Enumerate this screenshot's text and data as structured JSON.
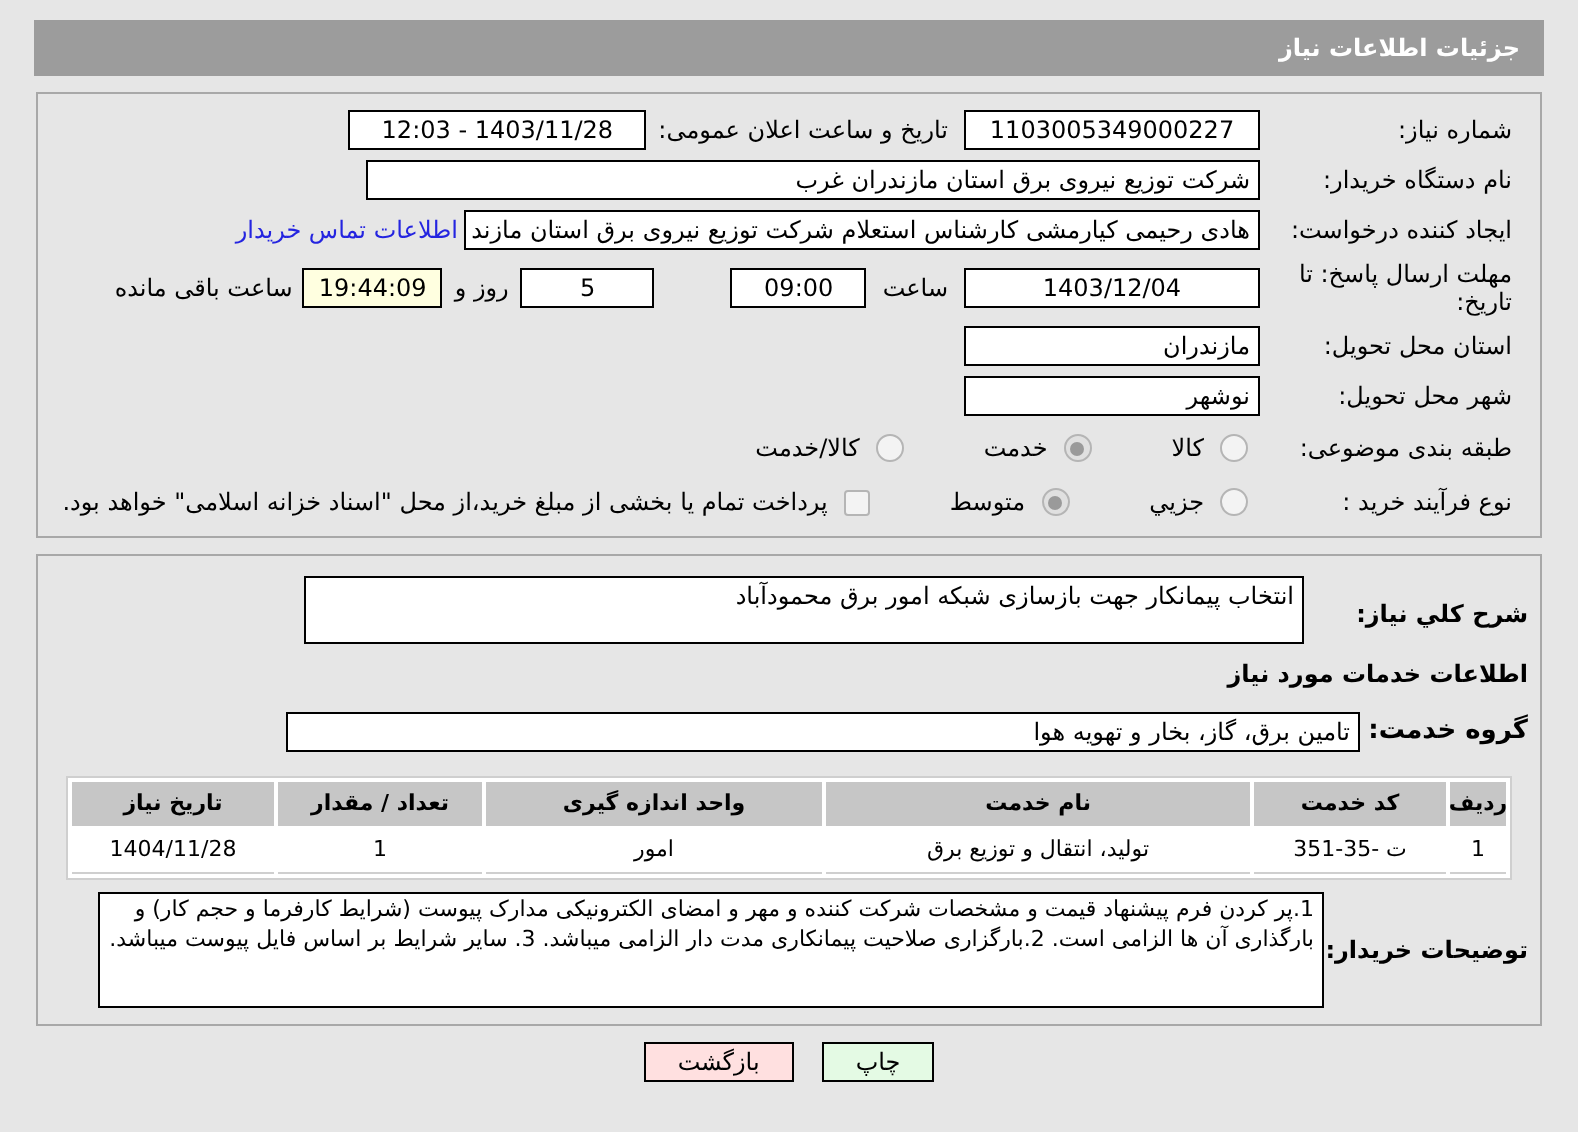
{
  "header": {
    "title": "جزئیات اطلاعات نیاز"
  },
  "details": {
    "need_number": {
      "label": "شماره نیاز:",
      "value": "1103005349000227"
    },
    "announce": {
      "label": "تاریخ و ساعت اعلان عمومی:",
      "value": "1403/11/28 - 12:03"
    },
    "buyer": {
      "label": "نام دستگاه خریدار:",
      "value": "شرکت توزیع نیروی برق استان مازندران غرب"
    },
    "creator": {
      "label": "ایجاد کننده درخواست:",
      "value": "هادی رحیمی کیارمشی کارشناس استعلام شرکت توزیع نیروی برق استان مازند",
      "link": "اطلاعات تماس خریدار"
    },
    "deadline": {
      "label": "مهلت ارسال پاسخ: تا تاریخ:",
      "date": "1403/12/04",
      "time_label": "ساعت",
      "time": "09:00",
      "days": "5",
      "days_label": "روز و",
      "remaining": "19:44:09",
      "remaining_label": "ساعت باقی مانده"
    },
    "province": {
      "label": "استان محل تحویل:",
      "value": "مازندران"
    },
    "city": {
      "label": "شهر محل تحویل:",
      "value": "نوشهر"
    },
    "category": {
      "label": "طبقه بندی موضوعی:",
      "options": [
        {
          "label": "کالا",
          "selected": false
        },
        {
          "label": "خدمت",
          "selected": true
        },
        {
          "label": "کالا/خدمت",
          "selected": false
        }
      ]
    },
    "process": {
      "label": "نوع فرآیند خرید :",
      "options": [
        {
          "label": "جزیي",
          "selected": false
        },
        {
          "label": "متوسط",
          "selected": true
        }
      ],
      "payment": {
        "checked": false,
        "text": "پرداخت تمام یا بخشی از مبلغ خرید،از محل \"اسناد خزانه اسلامی\" خواهد بود."
      }
    }
  },
  "services": {
    "description": {
      "label": "شرح کلي نياز:",
      "value": "انتخاب پیمانکار جهت بازسازی شبکه امور برق محمودآباد"
    },
    "section_title": "اطلاعات خدمات مورد نياز",
    "group": {
      "label": "گروه خدمت:",
      "value": "تامین برق، گاز، بخار و تهویه هوا"
    },
    "table": {
      "columns": [
        "ردیف",
        "کد خدمت",
        "نام خدمت",
        "واحد اندازه گیری",
        "تعداد / مقدار",
        "تاریخ نیاز"
      ],
      "rows": [
        [
          "1",
          "ت -35-351",
          "تولید، انتقال و توزیع برق",
          "امور",
          "1",
          "1404/11/28"
        ]
      ]
    },
    "notes": {
      "label": "توضیحات خریدار:",
      "value": "1.پر کردن فرم پیشنهاد قیمت و مشخصات شرکت کننده و مهر و امضای الکترونیکی مدارک پیوست (شرایط کارفرما و حجم کار) و بارگذاری آن ها الزامی است. 2.بارگزاری صلاحیت پیمانکاری مدت دار الزامی میباشد. 3. سایر شرایط بر اساس فایل پیوست میباشد."
    }
  },
  "buttons": [
    {
      "label": "چاپ",
      "kind": "print"
    },
    {
      "label": "بازگشت",
      "kind": "back"
    }
  ]
}
